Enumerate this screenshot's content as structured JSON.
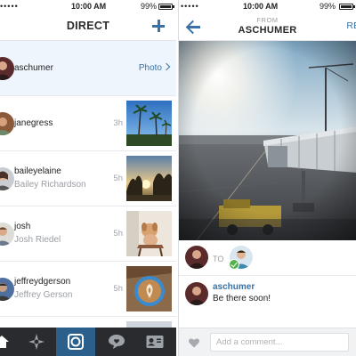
{
  "status_left": {
    "carrier": "•••••",
    "time": "10:00 AM",
    "battery": "99%"
  },
  "status_right": {
    "carrier": "•••••",
    "time": "10:00 AM",
    "battery": "99%"
  },
  "inbox": {
    "title": "DIRECT",
    "new_icon": "plus-icon",
    "threads": [
      {
        "name": "aschumer",
        "subtitle": "",
        "age": "",
        "action": "Photo",
        "selected": true
      },
      {
        "name": "janegress",
        "subtitle": "",
        "age": "3h",
        "thumb": "palm-trees-photo"
      },
      {
        "name": "baileyelaine",
        "subtitle": "Bailey Richardson",
        "age": "5h",
        "thumb": "sunset-trees-photo"
      },
      {
        "name": "josh",
        "subtitle": "Josh Riedel",
        "age": "5h",
        "thumb": "dog-on-chair-photo"
      },
      {
        "name": "jeffreydgerson",
        "subtitle": "Jeffrey Gerson",
        "age": "5h",
        "thumb": "latte-art-photo"
      }
    ]
  },
  "tabs": [
    {
      "icon": "home-icon",
      "active": false
    },
    {
      "icon": "explore-star-icon",
      "active": false
    },
    {
      "icon": "camera-icon",
      "active": true
    },
    {
      "icon": "activity-bubble-icon",
      "active": false
    },
    {
      "icon": "profile-card-icon",
      "active": false
    }
  ],
  "detail": {
    "from_label": "FROM",
    "from_name": "ASCHUMER",
    "reply_label": "RE",
    "to_label": "TO",
    "message": {
      "author": "aschumer",
      "text": "Be there soon!"
    },
    "comment_placeholder": "Add a comment..."
  },
  "colors": {
    "accent": "#3a72a8",
    "tabbar": "#2a2b2e",
    "tab_active": "#2b5f8c",
    "selected_row": "#eef5fc"
  }
}
